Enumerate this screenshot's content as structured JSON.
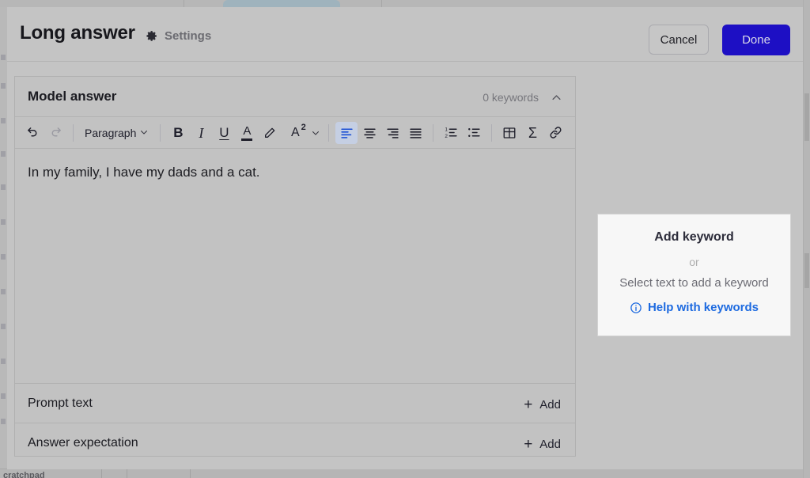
{
  "background": {
    "bottom_partial_label": "cratchpad"
  },
  "header": {
    "title": "Long answer",
    "settings_label": "Settings",
    "settings_icon": "gear-icon",
    "cancel_label": "Cancel",
    "done_label": "Done",
    "done_color": "#1d0fc4"
  },
  "card": {
    "section_title": "Model answer",
    "keyword_count": "0 keywords",
    "collapse_icon": "chevron-up-icon",
    "toolbar": {
      "undo": "undo-icon",
      "redo": "redo-icon",
      "block_format": "Paragraph",
      "bold": "B",
      "italic": "I",
      "underline": "U",
      "text_color": "A",
      "highlight": "pencil-icon",
      "superscript": "A",
      "superscript_sup": "2",
      "align_left": "align-left-icon",
      "align_center": "align-center-icon",
      "align_right": "align-right-icon",
      "align_justify": "align-justify-icon",
      "numbered_list": "numbered-list-icon",
      "bullet_list": "bullet-list-icon",
      "table": "table-icon",
      "equation": "Σ",
      "link": "link-icon",
      "active_button": "align-left-icon",
      "disabled_button": "redo-icon",
      "active_color": "#1b4fd4"
    },
    "editor_text": "In my family, I have my dads and a cat.",
    "rows": [
      {
        "label": "Prompt text",
        "add_plus": "+",
        "add_label": "Add"
      },
      {
        "label": "Answer expectation",
        "add_plus": "+",
        "add_label": "Add"
      }
    ]
  },
  "keyword_panel": {
    "title": "Add keyword",
    "or": "or",
    "subtitle": "Select text to add a keyword",
    "help_label": "Help with keywords",
    "help_icon": "info-circle-icon",
    "help_color": "#1d6ae0"
  }
}
